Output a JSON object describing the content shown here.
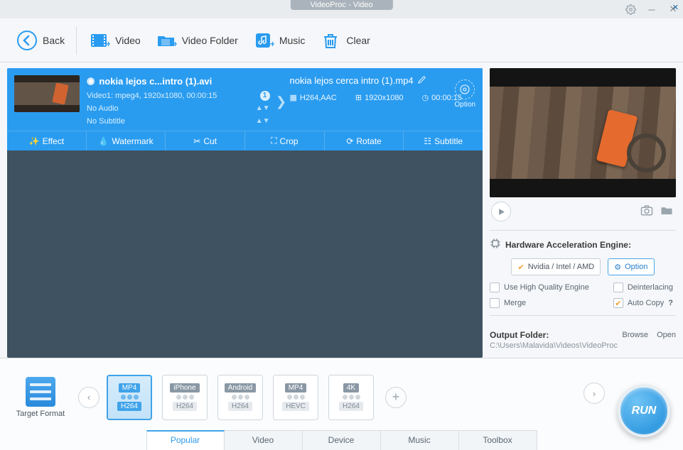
{
  "titlebar": {
    "title": "VideoProc - Video"
  },
  "toolbar": {
    "back": "Back",
    "video": "Video",
    "video_folder": "Video Folder",
    "music": "Music",
    "clear": "Clear"
  },
  "item": {
    "src_title": "nokia lejos c...intro (1).avi",
    "src_line1": "Video1: mpeg4, 1920x1080, 00:00:15",
    "src_line2": "No Audio",
    "src_line3": "No Subtitle",
    "badge": "1",
    "dst_title": "nokia lejos cerca intro (1).mp4",
    "dst_codec": "H264,AAC",
    "dst_res": "1920x1080",
    "dst_dur": "00:00:15",
    "option": "Option",
    "tools": {
      "effect": "Effect",
      "watermark": "Watermark",
      "cut": "Cut",
      "crop": "Crop",
      "rotate": "Rotate",
      "subtitle": "Subtitle"
    }
  },
  "hw": {
    "title": "Hardware Acceleration Engine:",
    "gpu": "Nvidia / Intel / AMD",
    "option": "Option",
    "hq": "Use High Quality Engine",
    "deint": "Deinterlacing",
    "merge": "Merge",
    "autocopy": "Auto Copy",
    "q": "?"
  },
  "output": {
    "label": "Output Folder:",
    "browse": "Browse",
    "open": "Open",
    "path": "C:\\Users\\Malavida\\Videos\\VideoProc"
  },
  "formats": {
    "target": "Target Format",
    "cards": [
      {
        "top": "MP4",
        "bot": "H264"
      },
      {
        "top": "iPhone",
        "bot": "H264"
      },
      {
        "top": "Android",
        "bot": "H264"
      },
      {
        "top": "MP4",
        "bot": "HEVC"
      },
      {
        "top": "4K",
        "bot": "H264"
      }
    ],
    "tabs": [
      "Popular",
      "Video",
      "Device",
      "Music",
      "Toolbox"
    ]
  },
  "run": "RUN"
}
